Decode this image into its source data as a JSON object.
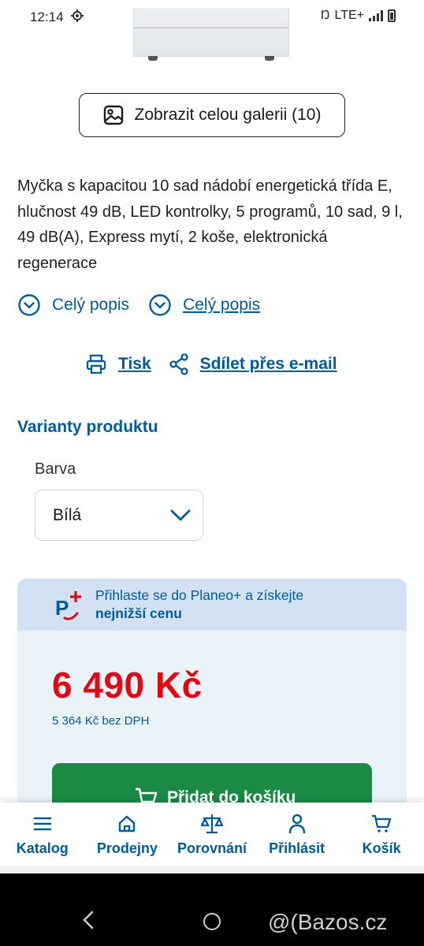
{
  "status_bar": {
    "time": "12:14",
    "network": "LTE+",
    "icons": [
      "gear-icon",
      "nfc-icon",
      "signal-icon",
      "battery-icon"
    ]
  },
  "gallery_button": {
    "label": "Zobrazit celou galerii (10)",
    "icon": "image-icon"
  },
  "description": "Myčka s kapacitou 10 sad nádobí energetická třída E, hlučnost 49 dB, LED kontrolky, 5 programů, 10 sad, 9 l, 49 dB(A), Express mytí, 2 koše, elektronická regenerace",
  "desc_links": [
    {
      "label": "Celý popis",
      "icon": "chevron-circle-down-icon"
    },
    {
      "label": "Celý popis",
      "icon": "chevron-circle-down-icon"
    }
  ],
  "share": {
    "print_label": "Tisk",
    "email_label": "Sdílet přes e-mail"
  },
  "variants": {
    "title": "Varianty produktu",
    "color_label": "Barva",
    "color_value": "Bílá"
  },
  "pricing": {
    "planeo_text": "Přihlaste se do Planeo+ a získejte",
    "planeo_bold": "nejnižší cenu",
    "price": "6 490 Kč",
    "price_net": "5 364 Kč bez DPH",
    "cart_button": "Přidat do košíku"
  },
  "bottom_nav": [
    {
      "label": "Katalog",
      "icon": "menu-icon"
    },
    {
      "label": "Prodejny",
      "icon": "home-icon"
    },
    {
      "label": "Porovnání",
      "icon": "scales-icon"
    },
    {
      "label": "Přihlásit",
      "icon": "user-icon"
    },
    {
      "label": "Košík",
      "icon": "cart-icon"
    }
  ],
  "watermark": "@(Bazos.cz",
  "colors": {
    "brand_blue": "#005a9c",
    "price_red": "#e30613",
    "cart_green": "#1a8a45",
    "panel_bg": "#eaf2fa",
    "planeo_bg": "#d2e2f2"
  }
}
